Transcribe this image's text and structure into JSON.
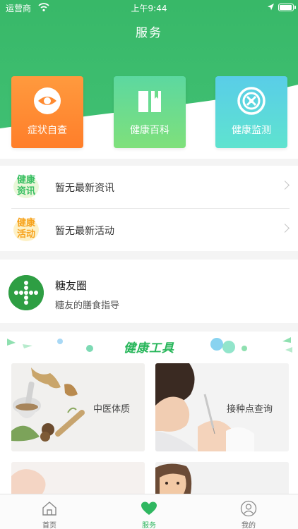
{
  "status_bar": {
    "carrier": "运营商",
    "time": "上午9:44"
  },
  "header": {
    "title": "服务"
  },
  "quick_cards": [
    {
      "label": "症状自查",
      "icon": "eye-icon"
    },
    {
      "label": "健康百科",
      "icon": "book-icon"
    },
    {
      "label": "健康监测",
      "icon": "monitor-icon"
    }
  ],
  "info_list": [
    {
      "badge_top": "健康",
      "badge_bottom": "资讯",
      "text": "暂无最新资讯"
    },
    {
      "badge_top": "健康",
      "badge_bottom": "活动",
      "text": "暂无最新活动"
    }
  ],
  "circle": {
    "title": "糖友圈",
    "subtitle": "糖友的膳食指导"
  },
  "tools": {
    "title": "健康工具",
    "items": [
      {
        "label": "中医体质"
      },
      {
        "label": "接种点查询"
      }
    ]
  },
  "tabbar": [
    {
      "label": "首页",
      "icon": "home-icon"
    },
    {
      "label": "服务",
      "icon": "heart-icon",
      "active": true
    },
    {
      "label": "我的",
      "icon": "user-icon"
    }
  ],
  "colors": {
    "primary": "#2fb760",
    "orange": "#ff8c33",
    "cyan": "#5cd6e0"
  }
}
